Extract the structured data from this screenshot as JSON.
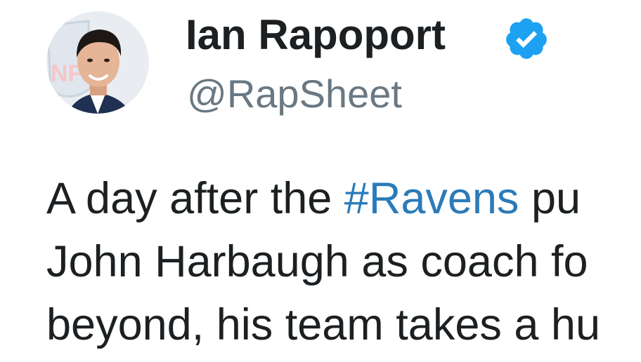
{
  "author": {
    "display_name": "Ian Rapoport",
    "handle": "@RapSheet",
    "verified_icon": "verified-badge-icon",
    "avatar_badge_text": "NFL"
  },
  "tweet": {
    "line1_before": "A day after the ",
    "hashtag": "#Ravens",
    "line1_after": " pu",
    "line2": "John Harbaugh as coach fo",
    "line3": "beyond, his team takes a hu"
  },
  "colors": {
    "text": "#1c2022",
    "secondary": "#697882",
    "link": "#2b7bb9",
    "verified": "#1da1f2"
  }
}
